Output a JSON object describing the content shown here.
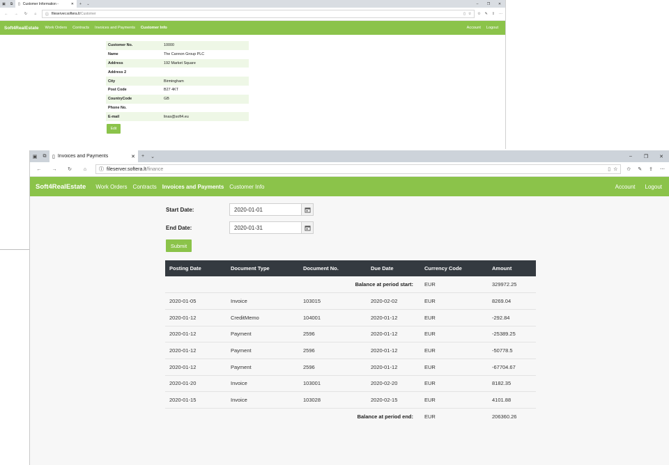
{
  "customer_window": {
    "tab_title": "Customer Information -",
    "url_host": "fileserver.softera.lt",
    "url_path": "/Customer",
    "brand": "Soft4RealEstate",
    "nav": [
      "Work Orders",
      "Contracts",
      "Invoices and Payments",
      "Customer Info"
    ],
    "nav_active": "Customer Info",
    "nav_right": [
      "Account",
      "Logout"
    ],
    "fields": [
      {
        "label": "Customer No.",
        "value": "10000"
      },
      {
        "label": "Name",
        "value": "The Cannon Group PLC"
      },
      {
        "label": "Address",
        "value": "192 Market Square"
      },
      {
        "label": "Address 2",
        "value": ""
      },
      {
        "label": "City",
        "value": "Birmingham"
      },
      {
        "label": "Post Code",
        "value": "B27 4KT"
      },
      {
        "label": "CountryCode",
        "value": "GB"
      },
      {
        "label": "Phone No.",
        "value": ""
      },
      {
        "label": "E-mail",
        "value": "linas@soft4.eu"
      }
    ],
    "edit_label": "Edit"
  },
  "finance_window": {
    "tab_title": "Invoices and Payments",
    "url_host": "fileserver.softera.lt",
    "url_path": "/finance",
    "brand": "Soft4RealEstate",
    "nav": [
      "Work Orders",
      "Contracts",
      "Invoices and Payments",
      "Customer Info"
    ],
    "nav_active": "Invoices and Payments",
    "nav_right": [
      "Account",
      "Logout"
    ],
    "start_date_label": "Start Date:",
    "start_date_value": "2020-01-01",
    "end_date_label": "End Date:",
    "end_date_value": "2020-01-31",
    "submit_label": "Submit",
    "table_headers": [
      "Posting Date",
      "Document Type",
      "Document No.",
      "Due Date",
      "Currency Code",
      "Amount"
    ],
    "balance_start_label": "Balance at period start:",
    "balance_start_currency": "EUR",
    "balance_start_amount": "329972.25",
    "rows": [
      [
        "2020-01-05",
        "Invoice",
        "103015",
        "2020-02-02",
        "EUR",
        "8269.04"
      ],
      [
        "2020-01-12",
        "CreditMemo",
        "104001",
        "2020-01-12",
        "EUR",
        "-292.84"
      ],
      [
        "2020-01-12",
        "Payment",
        "2596",
        "2020-01-12",
        "EUR",
        "-25389.25"
      ],
      [
        "2020-01-12",
        "Payment",
        "2596",
        "2020-01-12",
        "EUR",
        "-50778.5"
      ],
      [
        "2020-01-12",
        "Payment",
        "2596",
        "2020-01-12",
        "EUR",
        "-67704.67"
      ],
      [
        "2020-01-20",
        "Invoice",
        "103001",
        "2020-02-20",
        "EUR",
        "8182.35"
      ],
      [
        "2020-01-15",
        "Invoice",
        "103028",
        "2020-02-15",
        "EUR",
        "4101.88"
      ]
    ],
    "balance_end_label": "Balance at period end:",
    "balance_end_currency": "EUR",
    "balance_end_amount": "206360.26"
  },
  "colors": {
    "accent_green": "#8bc34a",
    "table_header": "#343a40",
    "stripe": "#eef7e6"
  },
  "icons": [
    "tab-actions-icon",
    "back-icon",
    "forward-icon",
    "refresh-icon",
    "home-icon",
    "info-icon",
    "reading-view-icon",
    "favorite-star-icon",
    "favorites-hub-icon",
    "pen-icon",
    "share-icon",
    "more-icon",
    "calendar-icon"
  ]
}
